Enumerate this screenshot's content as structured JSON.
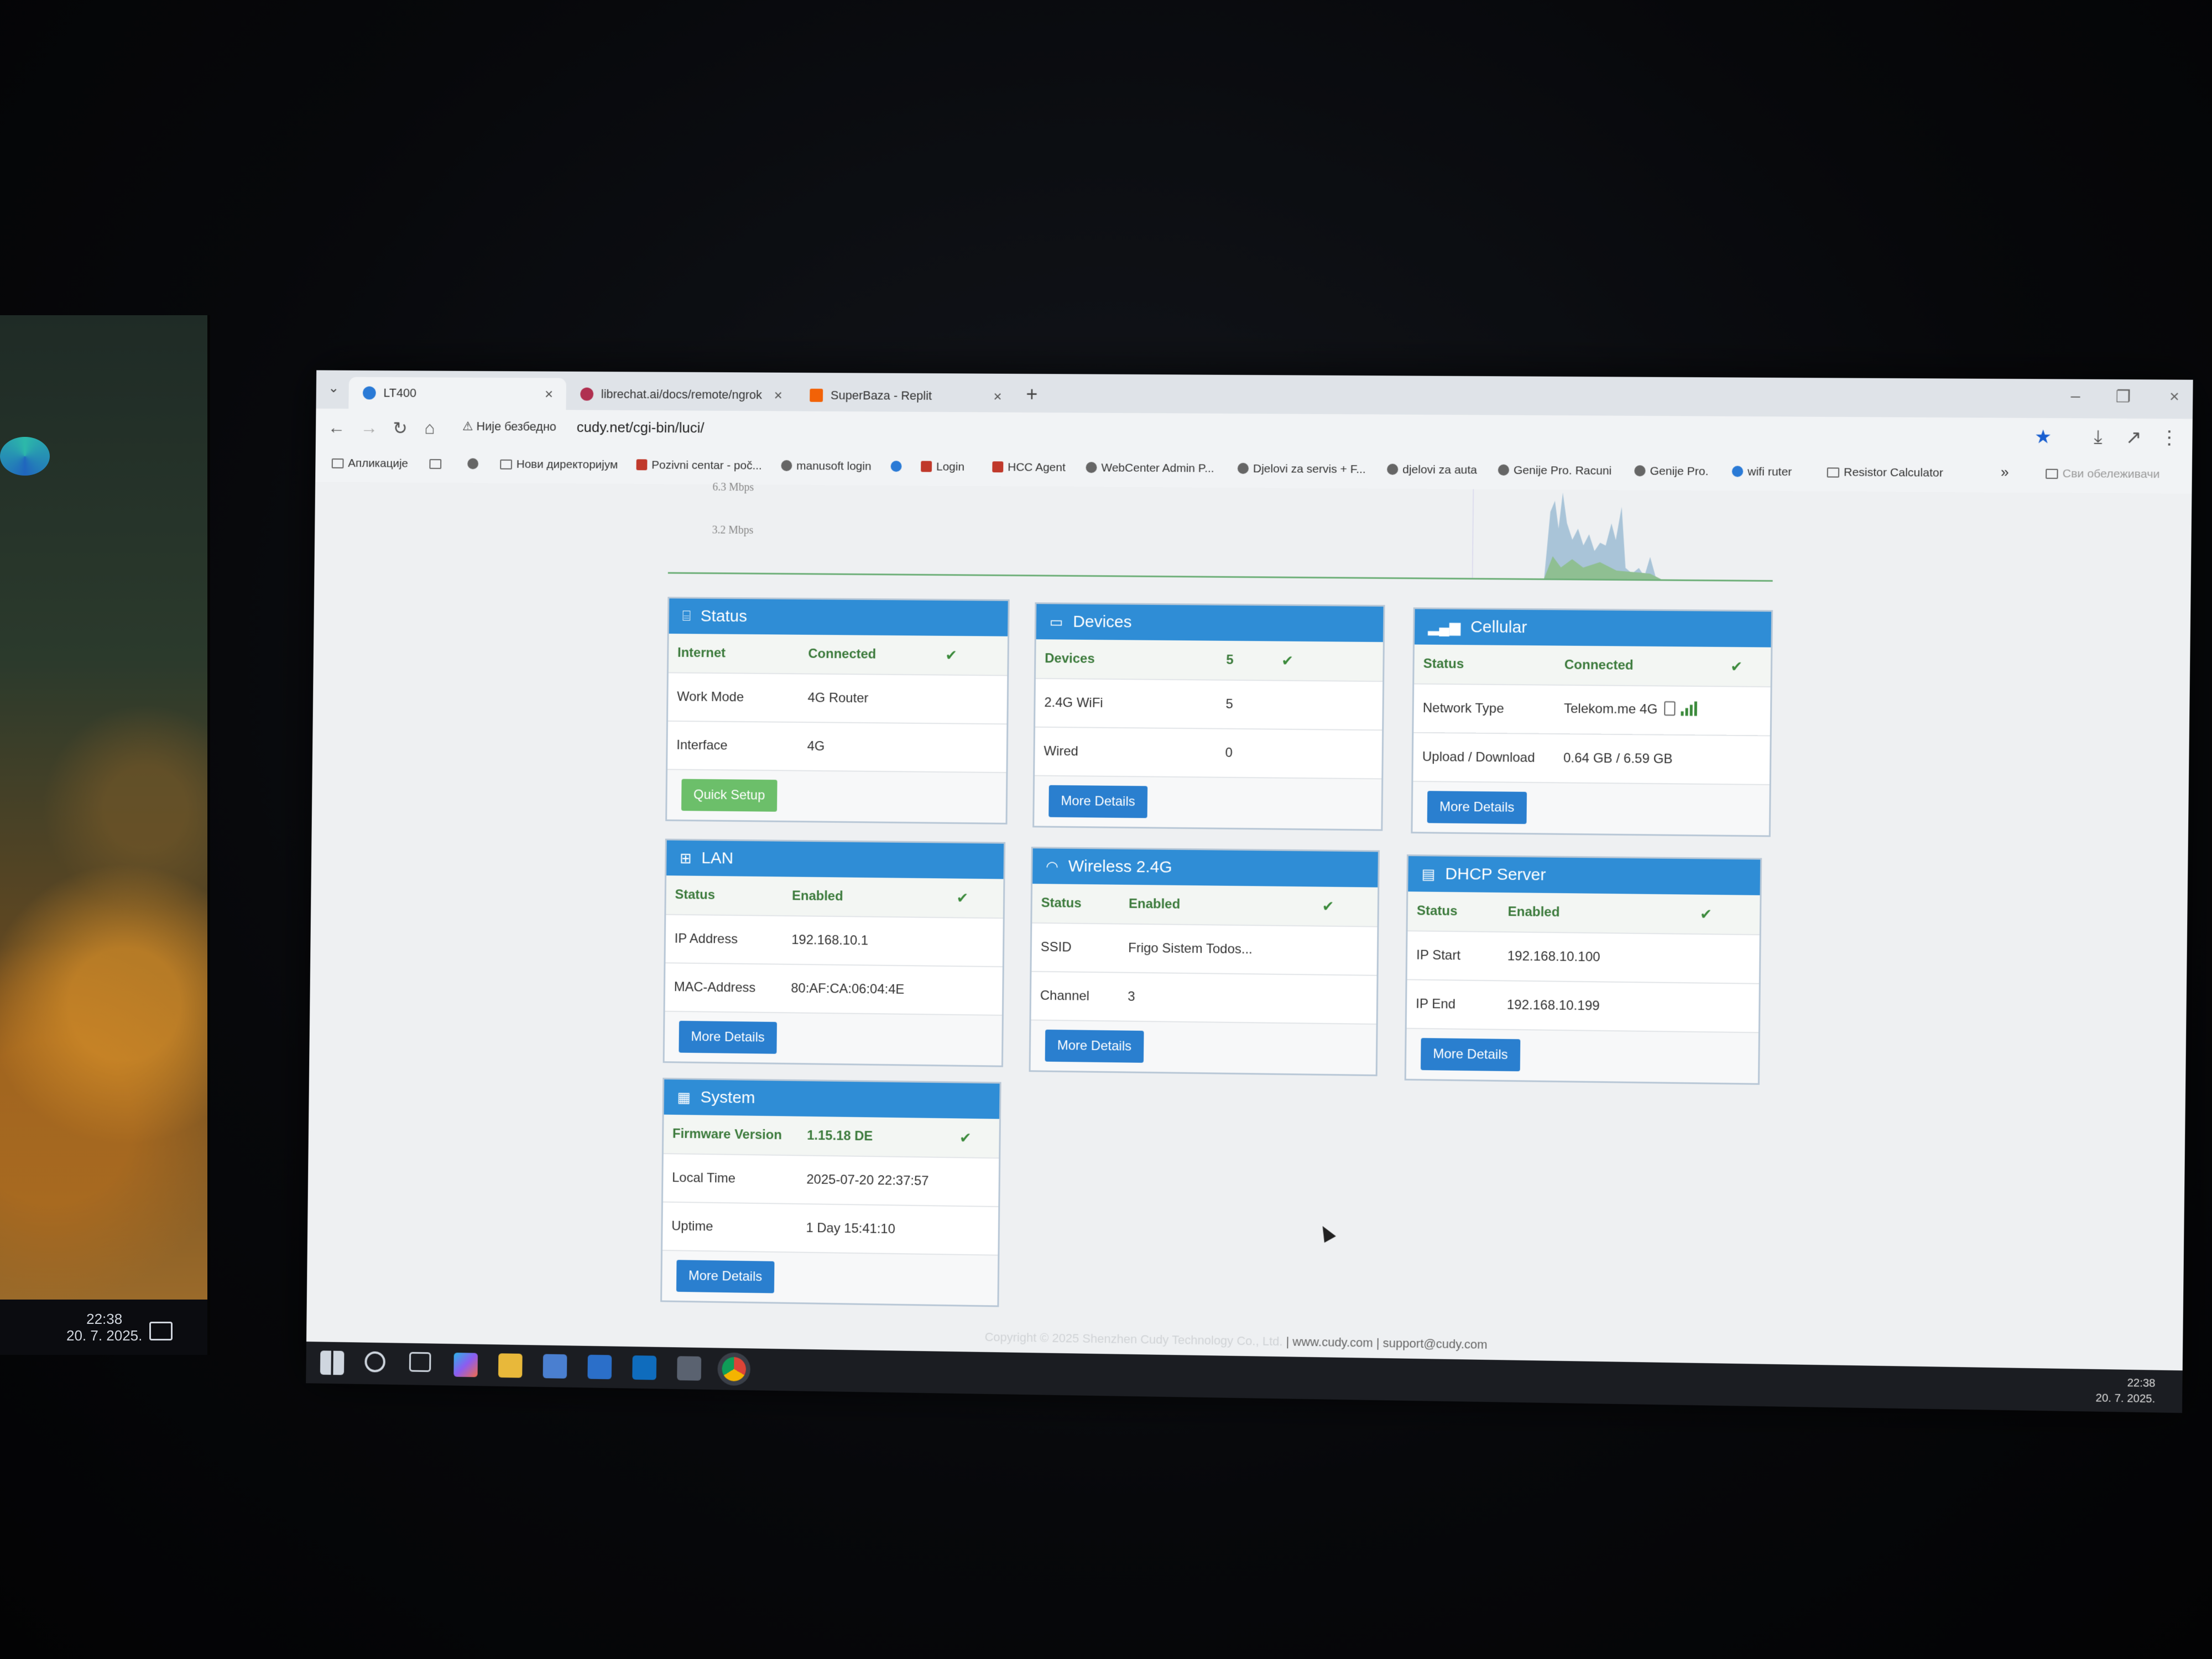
{
  "side_monitor": {
    "clock_time": "22:38",
    "clock_date": "20. 7. 2025."
  },
  "browser": {
    "tabs": [
      {
        "title": "LT400",
        "favicon": "cudy-icon",
        "color": "#2a7ad6"
      },
      {
        "title": "librechat.ai/docs/remote/ngrok",
        "favicon": "librechat-icon",
        "color": "#b03050"
      },
      {
        "title": "SuperBaza - Replit",
        "favicon": "replit-icon",
        "color": "#f26207"
      }
    ],
    "security_label": "Није безбедно",
    "url": "cudy.net/cgi-bin/luci/",
    "bookmarks": [
      {
        "label": "Апликације",
        "icon": "apps-grid-icon"
      },
      {
        "label": "",
        "icon": "grid-icon"
      },
      {
        "label": "",
        "icon": "globe-icon"
      },
      {
        "label": "Нови директоријум",
        "icon": "folder-icon"
      },
      {
        "label": "Pozivni centar - poč...",
        "icon": "telekom-icon"
      },
      {
        "label": "manusoft login",
        "icon": "globe-icon"
      },
      {
        "label": "",
        "icon": "triangle-icon"
      },
      {
        "label": "Login",
        "icon": "telekom-icon"
      },
      {
        "label": "HCC Agent",
        "icon": "telekom-icon"
      },
      {
        "label": "WebCenter Admin P...",
        "icon": "globe-icon"
      },
      {
        "label": "Djelovi za servis + F...",
        "icon": "globe-icon"
      },
      {
        "label": "djelovi za auta",
        "icon": "globe-icon"
      },
      {
        "label": "Genije Pro. Racuni",
        "icon": "globe-icon"
      },
      {
        "label": "Genije Pro.",
        "icon": "globe-icon"
      },
      {
        "label": "wifi ruter",
        "icon": "cudy-icon"
      },
      {
        "label": "Resistor Calculator",
        "icon": "calculator-icon"
      }
    ],
    "more_label": "»",
    "other_bookmarks": "Сви обележивачи"
  },
  "traffic_chart": {
    "ticks": [
      "6.3 Mbps",
      "3.2 Mbps"
    ]
  },
  "cards": {
    "status": {
      "title": "Status",
      "rows": [
        {
          "label": "Internet",
          "value": "Connected"
        },
        {
          "label": "Work Mode",
          "value": "4G Router"
        },
        {
          "label": "Interface",
          "value": "4G"
        }
      ],
      "button": "Quick Setup"
    },
    "devices": {
      "title": "Devices",
      "rows": [
        {
          "label": "Devices",
          "value": "5"
        },
        {
          "label": "2.4G WiFi",
          "value": "5"
        },
        {
          "label": "Wired",
          "value": "0"
        }
      ],
      "button": "More Details"
    },
    "cellular": {
      "title": "Cellular",
      "rows": [
        {
          "label": "Status",
          "value": "Connected"
        },
        {
          "label": "Network Type",
          "value": "Telekom.me 4G"
        },
        {
          "label": "Upload / Download",
          "value": "0.64 GB / 6.59 GB"
        }
      ],
      "button": "More Details"
    },
    "lan": {
      "title": "LAN",
      "rows": [
        {
          "label": "Status",
          "value": "Enabled"
        },
        {
          "label": "IP Address",
          "value": "192.168.10.1"
        },
        {
          "label": "MAC-Address",
          "value": "80:AF:CA:06:04:4E"
        }
      ],
      "button": "More Details"
    },
    "wireless": {
      "title": "Wireless 2.4G",
      "rows": [
        {
          "label": "Status",
          "value": "Enabled"
        },
        {
          "label": "SSID",
          "value": "Frigo Sistem Todos..."
        },
        {
          "label": "Channel",
          "value": "3"
        }
      ],
      "button": "More Details"
    },
    "dhcp": {
      "title": "DHCP Server",
      "rows": [
        {
          "label": "Status",
          "value": "Enabled"
        },
        {
          "label": "IP Start",
          "value": "192.168.10.100"
        },
        {
          "label": "IP End",
          "value": "192.168.10.199"
        }
      ],
      "button": "More Details"
    },
    "system": {
      "title": "System",
      "rows": [
        {
          "label": "Firmware Version",
          "value": "1.15.18 DE"
        },
        {
          "label": "Local Time",
          "value": "2025-07-20 22:37:57"
        },
        {
          "label": "Uptime",
          "value": "1 Day 15:41:10"
        }
      ],
      "button": "More Details"
    }
  },
  "footer": {
    "copyright": "Copyright © 2025 Shenzhen Cudy Technology Co., Ltd.",
    "website": "www.cudy.com",
    "email": "support@cudy.com"
  },
  "taskbar": {
    "time": "22:38",
    "date": "20. 7. 2025."
  }
}
